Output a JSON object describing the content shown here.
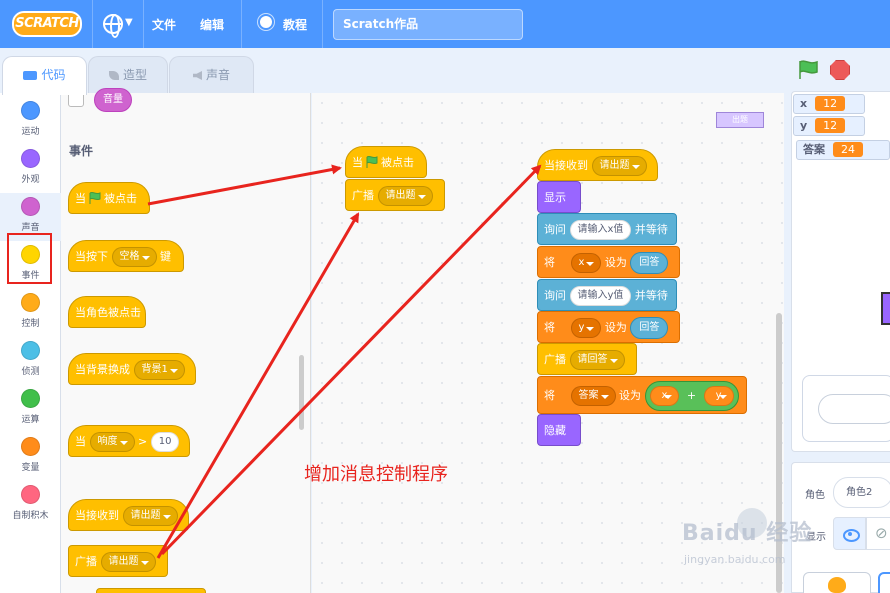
{
  "menubar": {
    "logo": "SCRATCH",
    "file": "文件",
    "edit": "编辑",
    "tutorials": "教程",
    "project_title": "Scratch作品"
  },
  "tabs": {
    "code": "代码",
    "costumes": "造型",
    "sounds": "声音"
  },
  "categories": [
    {
      "label": "运动",
      "color": "#4c97ff"
    },
    {
      "label": "外观",
      "color": "#9966ff"
    },
    {
      "label": "声音",
      "color": "#cf63cf"
    },
    {
      "label": "事件",
      "color": "#ffd500"
    },
    {
      "label": "控制",
      "color": "#ffab19"
    },
    {
      "label": "侦测",
      "color": "#4cbfe6"
    },
    {
      "label": "运算",
      "color": "#40bf4a"
    },
    {
      "label": "变量",
      "color": "#ff8c1a"
    },
    {
      "label": "自制积木",
      "color": "#ff6680"
    }
  ],
  "palette": {
    "volume_reporter": "音量",
    "section_title": "事件",
    "when_flag": {
      "pre": "当",
      "post": "被点击"
    },
    "when_key": {
      "pre": "当按下",
      "key": "空格",
      "post": "键"
    },
    "when_sprite_clicked": "当角色被点击",
    "when_backdrop": {
      "pre": "当背景换成",
      "value": "背景1"
    },
    "when_greater": {
      "pre": "当",
      "sensor": "响度",
      "op": ">",
      "value": "10"
    },
    "when_receive": {
      "pre": "当接收到",
      "value": "请出题"
    },
    "broadcast": {
      "pre": "广播",
      "value": "请出题"
    }
  },
  "workspace": {
    "script1": {
      "hat": {
        "pre": "当",
        "post": "被点击"
      },
      "broadcast": {
        "pre": "广播",
        "value": "请出题"
      }
    },
    "script2": {
      "hat": {
        "pre": "当接收到",
        "value": "请出题"
      },
      "show": "显示",
      "ask1": {
        "pre": "询问",
        "value": "请输入x值",
        "post": "并等待"
      },
      "set1": {
        "pre": "将",
        "var": "x",
        "mid": "设为",
        "value": "回答"
      },
      "ask2": {
        "pre": "询问",
        "value": "请输入y值",
        "post": "并等待"
      },
      "set2": {
        "pre": "将",
        "var": "y",
        "mid": "设为",
        "value": "回答"
      },
      "broadcast": {
        "pre": "广播",
        "value": "请回答"
      },
      "set3": {
        "pre": "将",
        "var": "答案",
        "mid": "设为",
        "a": "x",
        "op": "+",
        "b": "y"
      },
      "hide": "隐藏"
    },
    "mini_button": "出题",
    "annotation": "增加消息控制程序"
  },
  "stage": {
    "monitors": [
      {
        "label": "x",
        "value": "12"
      },
      {
        "label": "y",
        "value": "12"
      },
      {
        "label": "答案",
        "value": "24"
      }
    ]
  },
  "sprite_panel": {
    "sprite_label": "角色",
    "sprite_name": "角色2",
    "show_label": "显示"
  },
  "watermark": {
    "brand": "Baidu 经验",
    "url": "jingyan.baidu.com"
  },
  "colors": {
    "menubar": "#4c97ff",
    "events": "#ffbf00",
    "looks": "#9966ff",
    "sensing": "#5cb1d6",
    "variables": "#ff8c1a",
    "operators": "#59c059",
    "annotation": "#e8241e"
  }
}
